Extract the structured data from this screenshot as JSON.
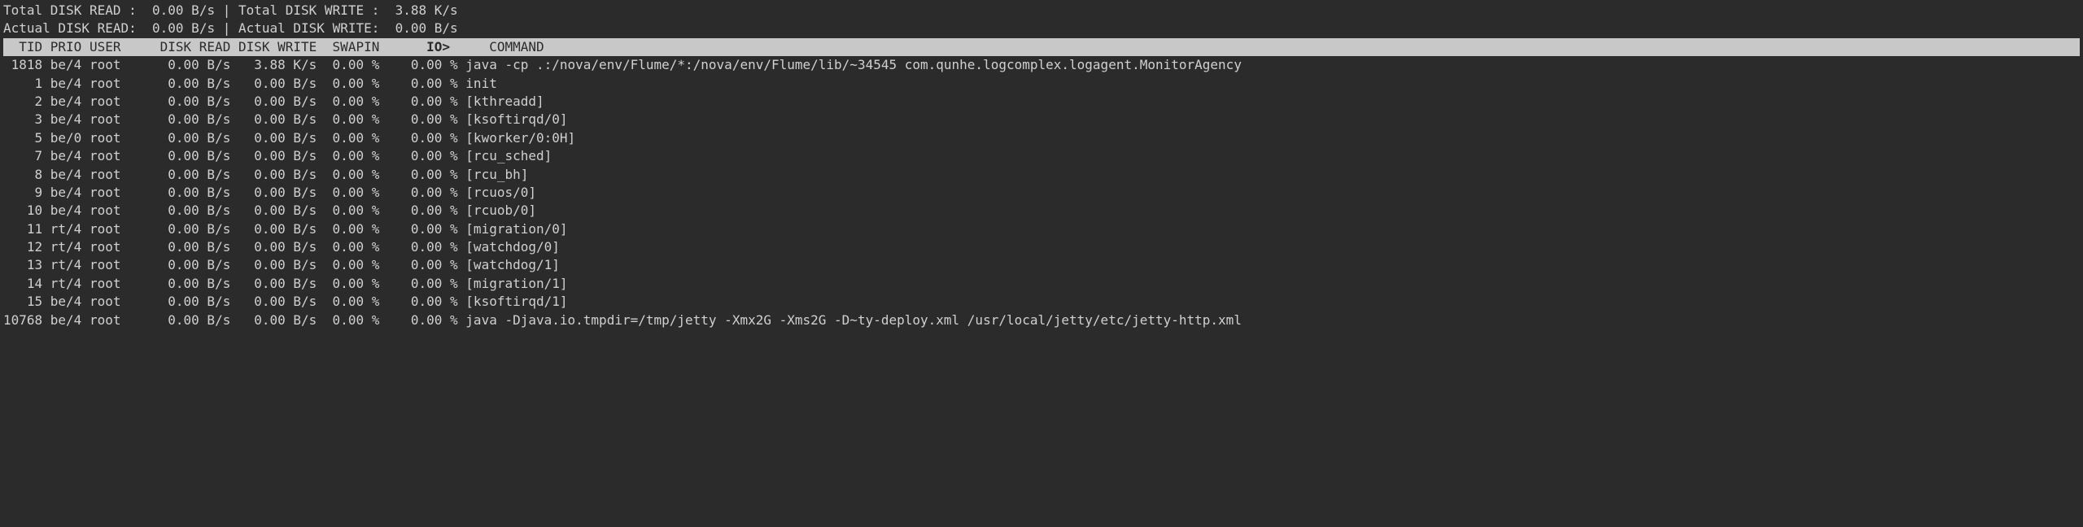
{
  "summary": {
    "total_read_label": "Total DISK READ :",
    "total_read_value": "0.00 B/s",
    "total_write_label": "Total DISK WRITE :",
    "total_write_value": "3.88 K/s",
    "actual_read_label": "Actual DISK READ:",
    "actual_read_value": "0.00 B/s",
    "actual_write_label": "Actual DISK WRITE:",
    "actual_write_value": "0.00 B/s",
    "divider": "|"
  },
  "headers": {
    "tid": "TID",
    "prio": "PRIO",
    "user": "USER",
    "disk_read": "DISK READ",
    "disk_write": "DISK WRITE",
    "swapin": "SWAPIN",
    "io": "IO>",
    "command": "COMMAND"
  },
  "rows": [
    {
      "tid": "1818",
      "prio": "be/4",
      "user": "root",
      "dr": "0.00 B/s",
      "dw": "3.88 K/s",
      "sw": "0.00 %",
      "io": "0.00 %",
      "cmd": "java -cp .:/nova/env/Flume/*:/nova/env/Flume/lib/~34545 com.qunhe.logcomplex.logagent.MonitorAgency"
    },
    {
      "tid": "1",
      "prio": "be/4",
      "user": "root",
      "dr": "0.00 B/s",
      "dw": "0.00 B/s",
      "sw": "0.00 %",
      "io": "0.00 %",
      "cmd": "init"
    },
    {
      "tid": "2",
      "prio": "be/4",
      "user": "root",
      "dr": "0.00 B/s",
      "dw": "0.00 B/s",
      "sw": "0.00 %",
      "io": "0.00 %",
      "cmd": "[kthreadd]"
    },
    {
      "tid": "3",
      "prio": "be/4",
      "user": "root",
      "dr": "0.00 B/s",
      "dw": "0.00 B/s",
      "sw": "0.00 %",
      "io": "0.00 %",
      "cmd": "[ksoftirqd/0]"
    },
    {
      "tid": "5",
      "prio": "be/0",
      "user": "root",
      "dr": "0.00 B/s",
      "dw": "0.00 B/s",
      "sw": "0.00 %",
      "io": "0.00 %",
      "cmd": "[kworker/0:0H]"
    },
    {
      "tid": "7",
      "prio": "be/4",
      "user": "root",
      "dr": "0.00 B/s",
      "dw": "0.00 B/s",
      "sw": "0.00 %",
      "io": "0.00 %",
      "cmd": "[rcu_sched]"
    },
    {
      "tid": "8",
      "prio": "be/4",
      "user": "root",
      "dr": "0.00 B/s",
      "dw": "0.00 B/s",
      "sw": "0.00 %",
      "io": "0.00 %",
      "cmd": "[rcu_bh]"
    },
    {
      "tid": "9",
      "prio": "be/4",
      "user": "root",
      "dr": "0.00 B/s",
      "dw": "0.00 B/s",
      "sw": "0.00 %",
      "io": "0.00 %",
      "cmd": "[rcuos/0]"
    },
    {
      "tid": "10",
      "prio": "be/4",
      "user": "root",
      "dr": "0.00 B/s",
      "dw": "0.00 B/s",
      "sw": "0.00 %",
      "io": "0.00 %",
      "cmd": "[rcuob/0]"
    },
    {
      "tid": "11",
      "prio": "rt/4",
      "user": "root",
      "dr": "0.00 B/s",
      "dw": "0.00 B/s",
      "sw": "0.00 %",
      "io": "0.00 %",
      "cmd": "[migration/0]"
    },
    {
      "tid": "12",
      "prio": "rt/4",
      "user": "root",
      "dr": "0.00 B/s",
      "dw": "0.00 B/s",
      "sw": "0.00 %",
      "io": "0.00 %",
      "cmd": "[watchdog/0]"
    },
    {
      "tid": "13",
      "prio": "rt/4",
      "user": "root",
      "dr": "0.00 B/s",
      "dw": "0.00 B/s",
      "sw": "0.00 %",
      "io": "0.00 %",
      "cmd": "[watchdog/1]"
    },
    {
      "tid": "14",
      "prio": "rt/4",
      "user": "root",
      "dr": "0.00 B/s",
      "dw": "0.00 B/s",
      "sw": "0.00 %",
      "io": "0.00 %",
      "cmd": "[migration/1]"
    },
    {
      "tid": "15",
      "prio": "be/4",
      "user": "root",
      "dr": "0.00 B/s",
      "dw": "0.00 B/s",
      "sw": "0.00 %",
      "io": "0.00 %",
      "cmd": "[ksoftirqd/1]"
    },
    {
      "tid": "10768",
      "prio": "be/4",
      "user": "root",
      "dr": "0.00 B/s",
      "dw": "0.00 B/s",
      "sw": "0.00 %",
      "io": "0.00 %",
      "cmd": "java -Djava.io.tmpdir=/tmp/jetty -Xmx2G -Xms2G -D~ty-deploy.xml /usr/local/jetty/etc/jetty-http.xml"
    }
  ]
}
